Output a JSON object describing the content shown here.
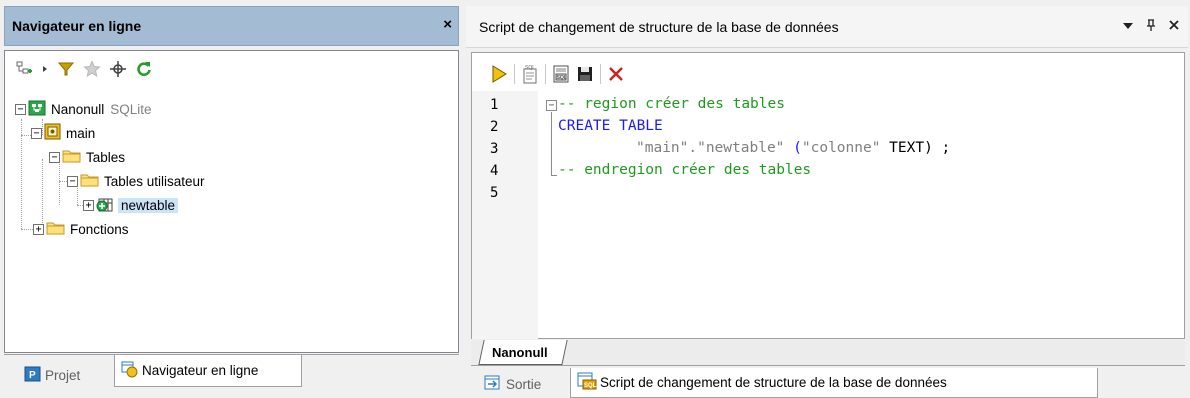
{
  "left_panel": {
    "title": "Navigateur en ligne",
    "close_label": "×",
    "toolbar": [
      "add-connection-icon",
      "expand-arrow-icon",
      "filter-icon",
      "favorite-star-icon",
      "locate-icon",
      "refresh-icon"
    ],
    "tree": {
      "connection": {
        "label": "Nanonull",
        "type": "SQLite"
      },
      "schema": "main",
      "tables_folder": "Tables",
      "user_tables_folder": "Tables utilisateur",
      "table": "newtable",
      "functions_folder": "Fonctions"
    },
    "tabs": [
      "Projet",
      "Navigateur en ligne"
    ]
  },
  "right_panel": {
    "title": "Script de changement de structure de la base de données",
    "controls": [
      "▼",
      "ᵖ",
      "×"
    ],
    "toolbar": [
      "execute-icon",
      "sql-script-icon",
      "open-sql-icon",
      "save-icon",
      "delete-icon"
    ],
    "line_numbers": [
      "1",
      "2",
      "3",
      "4",
      "5"
    ],
    "code": {
      "line1": "-- region créer des tables",
      "line2": "CREATE TABLE",
      "line3_a": "\"main\".\"newtable\"",
      "line3_b": " (",
      "line3_c": "\"colonne\"",
      "line3_d": " TEXT) ;",
      "line4": "-- endregion créer des tables"
    },
    "editor_tab": "Nanonull",
    "tabs": [
      "Sortie",
      "Script de changement de structure de la base de données"
    ]
  }
}
